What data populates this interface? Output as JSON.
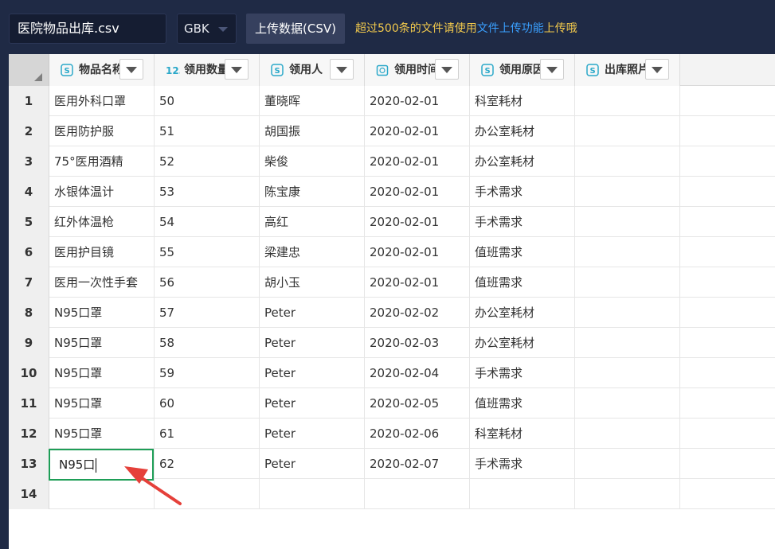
{
  "toolbar": {
    "file_name": "医院物品出库.csv",
    "encoding": "GBK",
    "upload_button": "上传数据(CSV)",
    "hint_prefix": "超过500条的文件请使用",
    "hint_link": "文件上传功能",
    "hint_suffix": "上传哦"
  },
  "columns": [
    {
      "title": "物品名称",
      "type_icon": "text-type-icon"
    },
    {
      "title": "领用数量",
      "type_icon": "number-type-icon"
    },
    {
      "title": "领用人",
      "type_icon": "text-type-icon"
    },
    {
      "title": "领用时间",
      "type_icon": "date-type-icon"
    },
    {
      "title": "领用原因",
      "type_icon": "text-type-icon"
    },
    {
      "title": "出库照片",
      "type_icon": "text-type-icon"
    }
  ],
  "rows": [
    {
      "num": "1",
      "cells": [
        "医用外科口罩",
        "50",
        "董晓晖",
        "2020-02-01",
        "科室耗材",
        ""
      ]
    },
    {
      "num": "2",
      "cells": [
        "医用防护服",
        "51",
        "胡国振",
        "2020-02-01",
        "办公室耗材",
        ""
      ]
    },
    {
      "num": "3",
      "cells": [
        "75°医用酒精",
        "52",
        "柴俊",
        "2020-02-01",
        "办公室耗材",
        ""
      ]
    },
    {
      "num": "4",
      "cells": [
        "水银体温计",
        "53",
        "陈宝康",
        "2020-02-01",
        "手术需求",
        ""
      ]
    },
    {
      "num": "5",
      "cells": [
        "红外体温枪",
        "54",
        "高红",
        "2020-02-01",
        "手术需求",
        ""
      ]
    },
    {
      "num": "6",
      "cells": [
        "医用护目镜",
        "55",
        "梁建忠",
        "2020-02-01",
        "值班需求",
        ""
      ]
    },
    {
      "num": "7",
      "cells": [
        "医用一次性手套",
        "56",
        "胡小玉",
        "2020-02-01",
        "值班需求",
        ""
      ]
    },
    {
      "num": "8",
      "cells": [
        "N95口罩",
        "57",
        "Peter",
        "2020-02-02",
        "办公室耗材",
        ""
      ]
    },
    {
      "num": "9",
      "cells": [
        "N95口罩",
        "58",
        "Peter",
        "2020-02-03",
        "办公室耗材",
        ""
      ]
    },
    {
      "num": "10",
      "cells": [
        "N95口罩",
        "59",
        "Peter",
        "2020-02-04",
        "手术需求",
        ""
      ]
    },
    {
      "num": "11",
      "cells": [
        "N95口罩",
        "60",
        "Peter",
        "2020-02-05",
        "值班需求",
        ""
      ]
    },
    {
      "num": "12",
      "cells": [
        "N95口罩",
        "61",
        "Peter",
        "2020-02-06",
        "科室耗材",
        ""
      ]
    },
    {
      "num": "13",
      "cells": [
        "N95口",
        "62",
        "Peter",
        "2020-02-07",
        "手术需求",
        ""
      ]
    },
    {
      "num": "14",
      "cells": [
        "",
        "",
        "",
        "",
        "",
        ""
      ]
    }
  ],
  "editing_cell": {
    "value": "N95口"
  },
  "colors": {
    "header_bg": "#1f2a45",
    "hint_yellow": "#f2c94c",
    "link_blue": "#3aa0ff",
    "edit_border": "#1e9e57",
    "arrow_red": "#e5403a"
  }
}
